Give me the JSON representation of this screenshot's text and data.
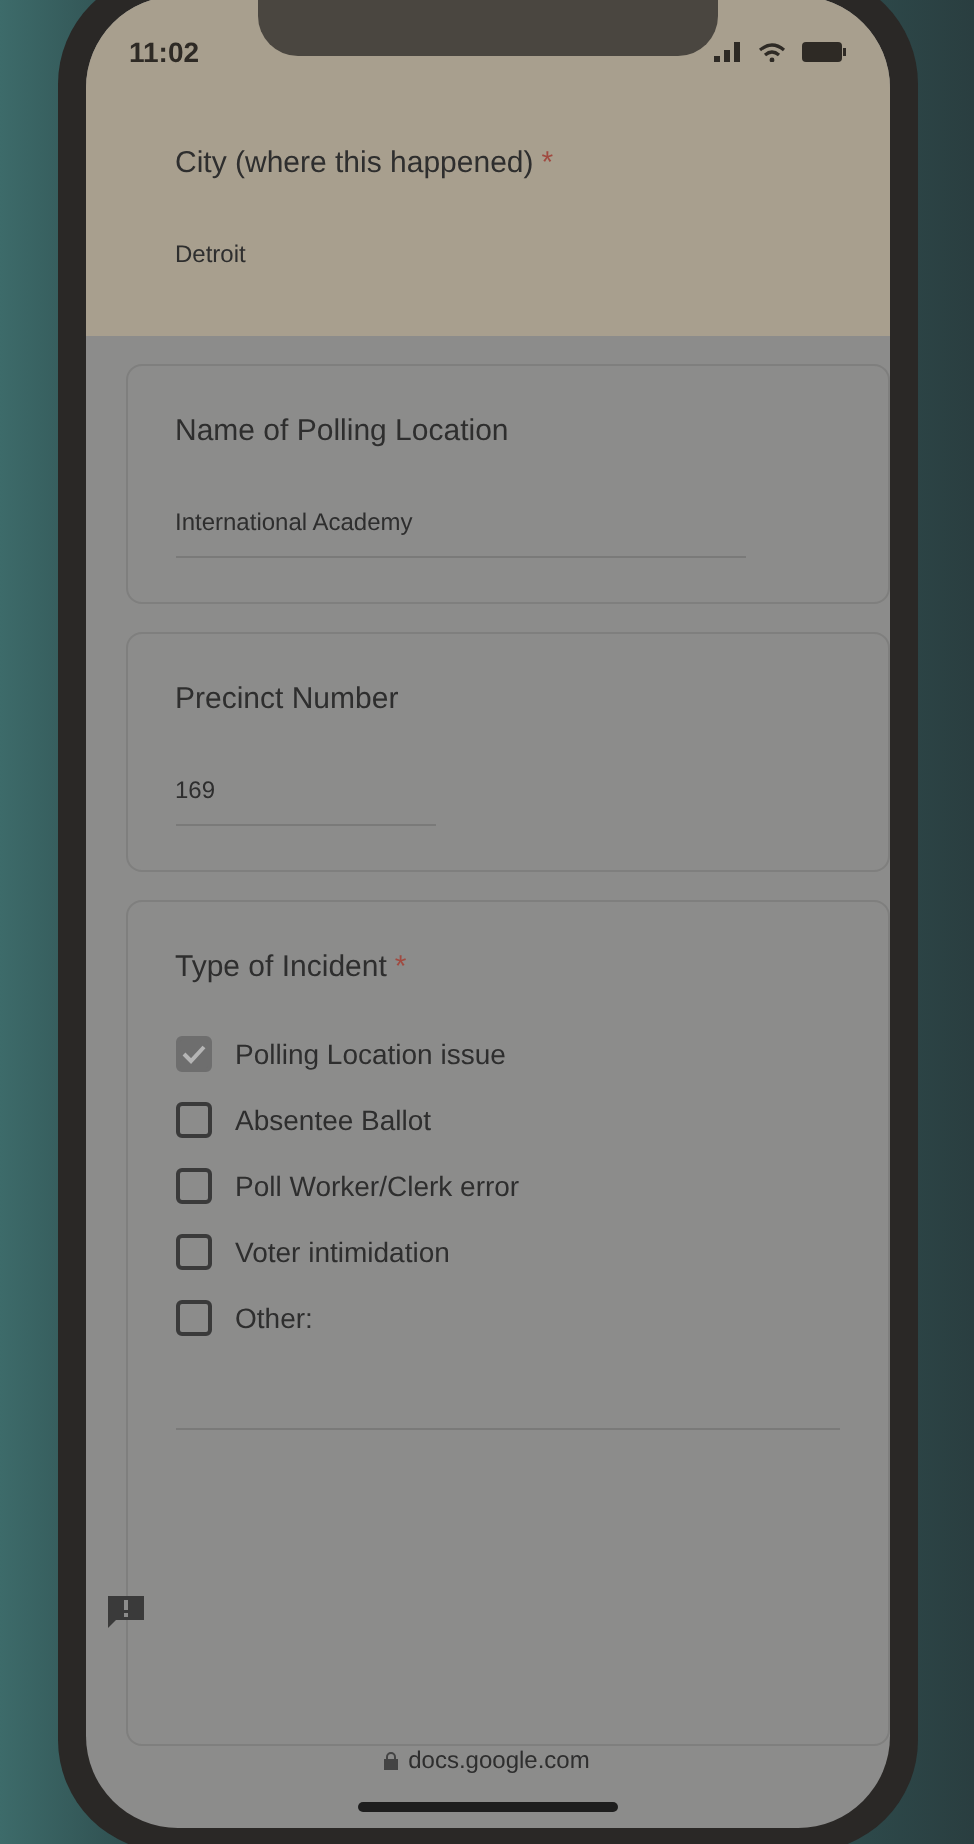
{
  "status_bar": {
    "time": "11:02"
  },
  "questions": [
    {
      "kind": "text",
      "label": "City (where this happened)",
      "required_mark": "*",
      "value": "Detroit"
    },
    {
      "kind": "text",
      "label": "Name of Polling Location",
      "value": "International Academy"
    },
    {
      "kind": "text",
      "label": "Precinct Number",
      "value": "169"
    },
    {
      "kind": "checkboxes",
      "label": "Type of Incident",
      "required_mark": "*",
      "options": [
        {
          "label": "Polling Location issue",
          "checked": true
        },
        {
          "label": "Absentee Ballot",
          "checked": false
        },
        {
          "label": "Poll Worker/Clerk error",
          "checked": false
        },
        {
          "label": "Voter intimidation",
          "checked": false
        },
        {
          "label": "Other:",
          "checked": false
        }
      ]
    }
  ],
  "address_bar": {
    "url": "docs.google.com"
  }
}
